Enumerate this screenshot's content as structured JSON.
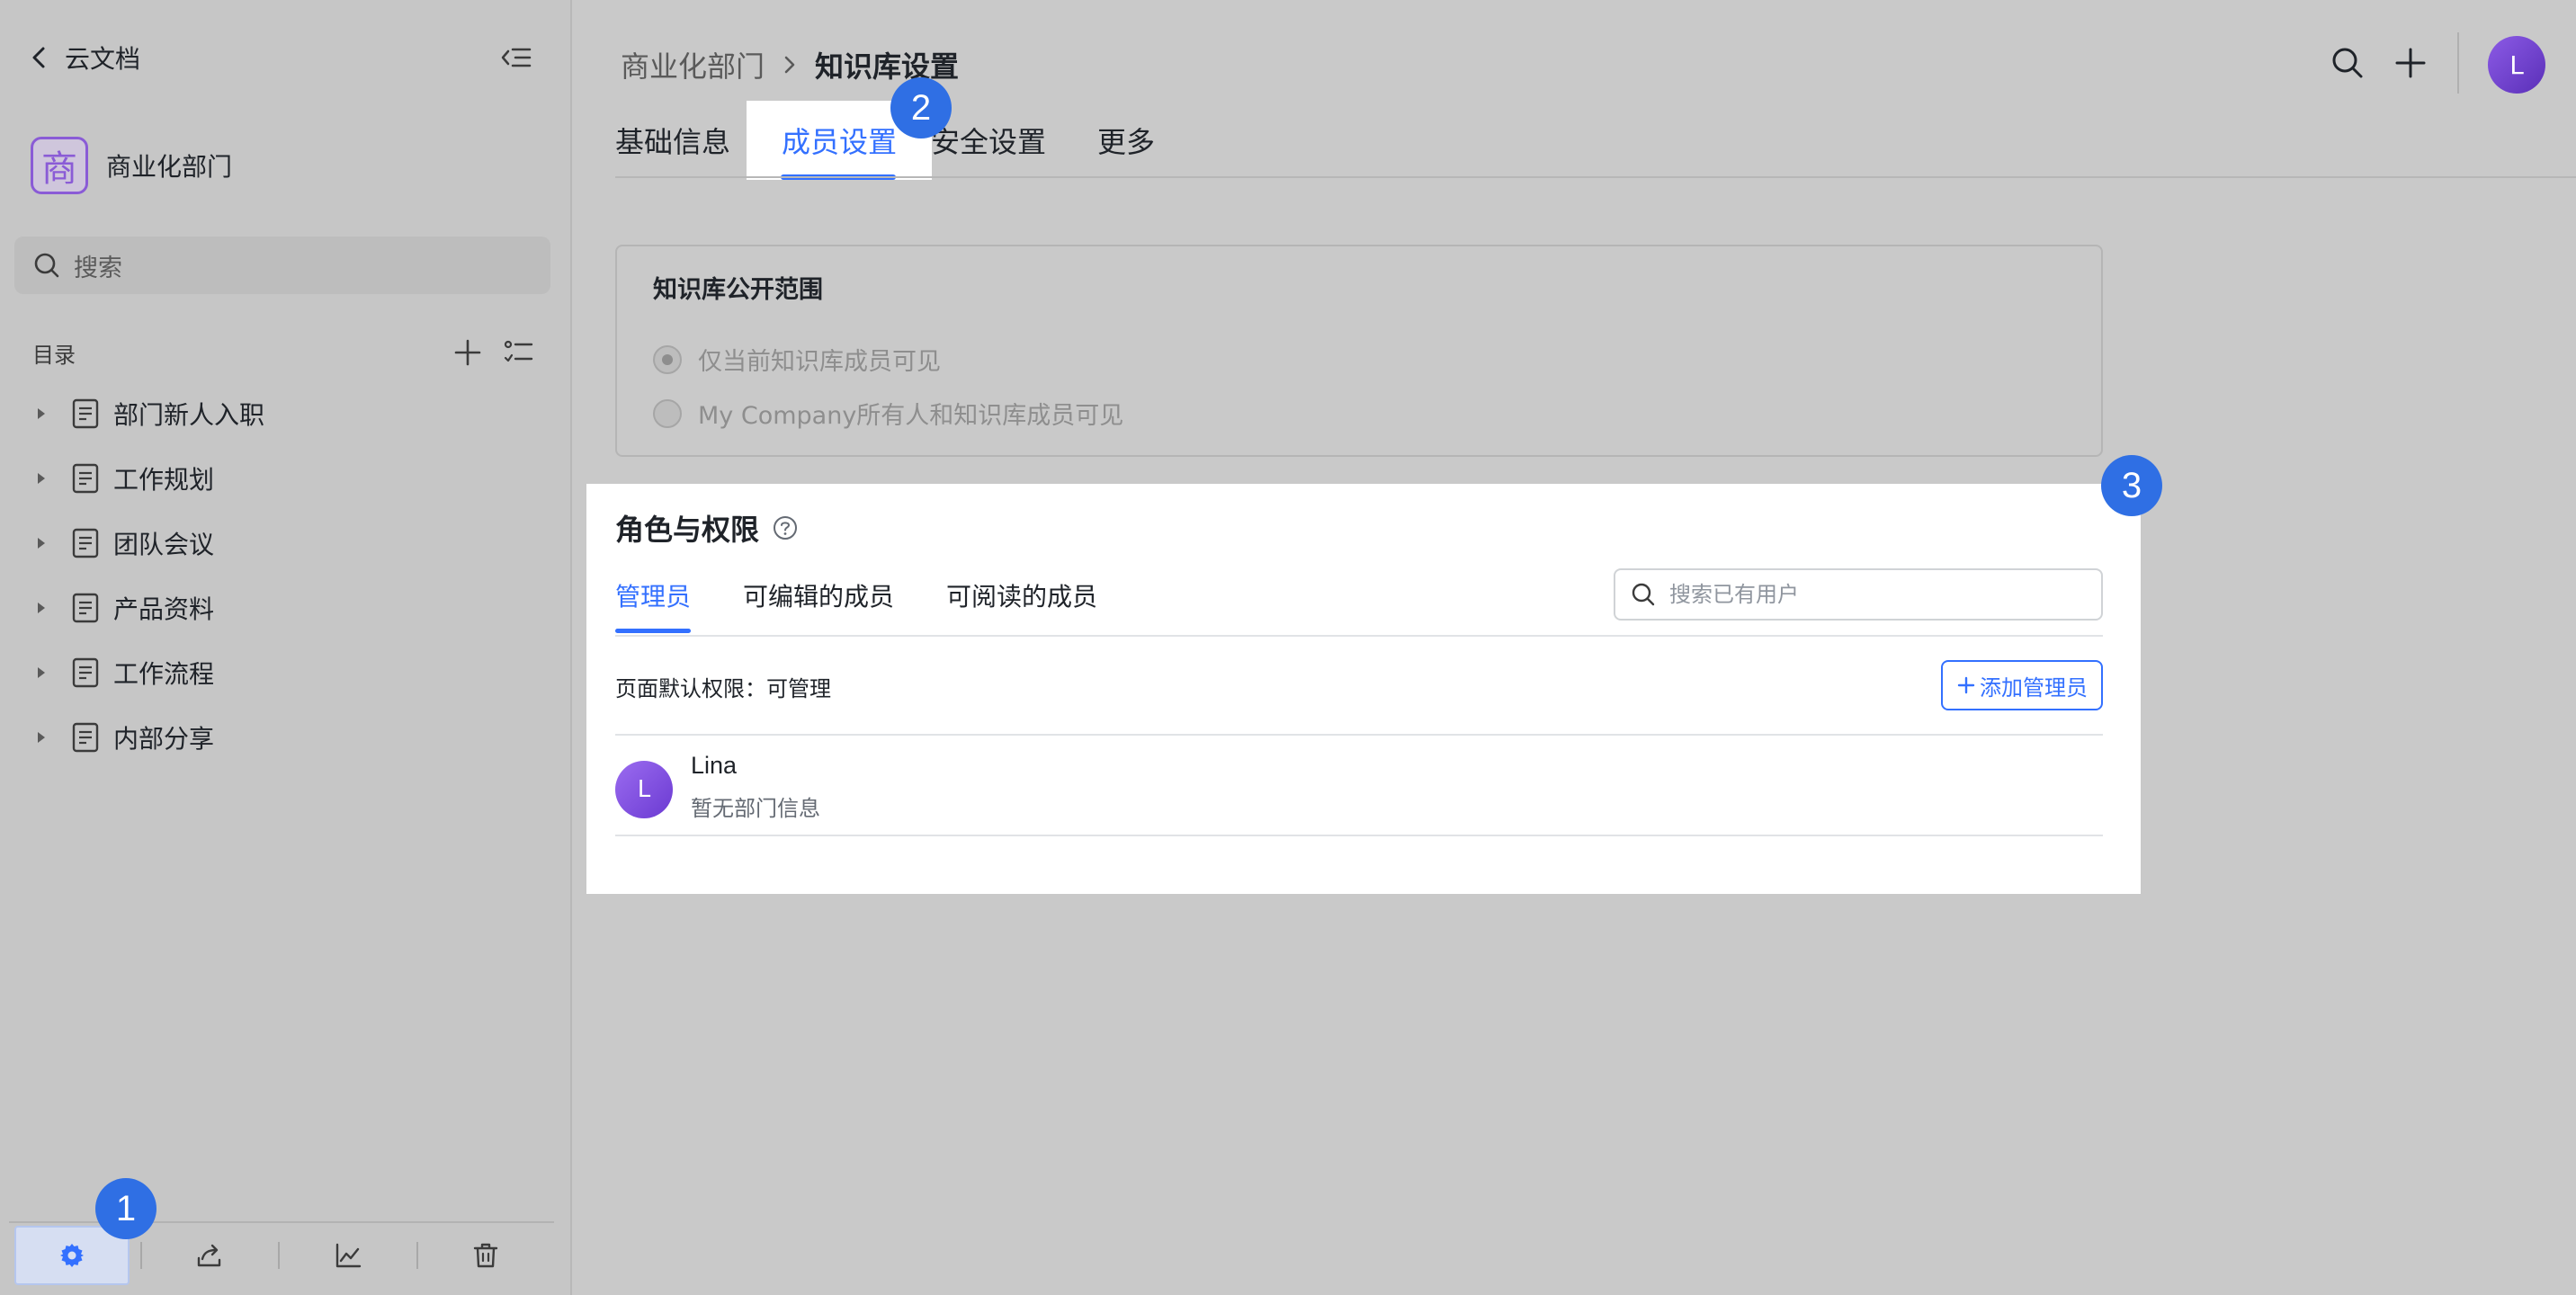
{
  "sidebar": {
    "title": "云文档",
    "workspace": {
      "logo_char": "商",
      "name": "商业化部门"
    },
    "search_placeholder": "搜索",
    "toc_label": "目录",
    "toc_items": [
      {
        "label": "部门新人入职"
      },
      {
        "label": "工作规划"
      },
      {
        "label": "团队会议"
      },
      {
        "label": "产品资料"
      },
      {
        "label": "工作流程"
      },
      {
        "label": "内部分享"
      }
    ],
    "bottom_buttons": [
      "settings-icon",
      "share-icon",
      "chart-icon",
      "trash-icon"
    ]
  },
  "header": {
    "breadcrumb_parent": "商业化部门",
    "breadcrumb_current": "知识库设置",
    "avatar_initial": "L"
  },
  "tabs": [
    {
      "label": "基础信息"
    },
    {
      "label": "成员设置",
      "active": true
    },
    {
      "label": "安全设置"
    },
    {
      "label": "更多"
    }
  ],
  "scope": {
    "title": "知识库公开范围",
    "options": [
      {
        "label": "仅当前知识库成员可见",
        "selected": true
      },
      {
        "label": "My Company所有人和知识库成员可见",
        "selected": false
      }
    ]
  },
  "roles": {
    "title": "角色与权限",
    "tabs": [
      {
        "label": "管理员",
        "active": true
      },
      {
        "label": "可编辑的成员"
      },
      {
        "label": "可阅读的成员"
      }
    ],
    "search_placeholder": "搜索已有用户",
    "default_permission": "页面默认权限：可管理",
    "add_button": "添加管理员",
    "members": [
      {
        "initial": "L",
        "name": "Lina",
        "dept": "暂无部门信息"
      }
    ]
  },
  "badges": [
    "1",
    "2",
    "3"
  ],
  "colors": {
    "accent": "#3370ff",
    "badge": "#2f6fe4",
    "workspace": "#8a5bd6",
    "avatar": "#7b46de"
  }
}
